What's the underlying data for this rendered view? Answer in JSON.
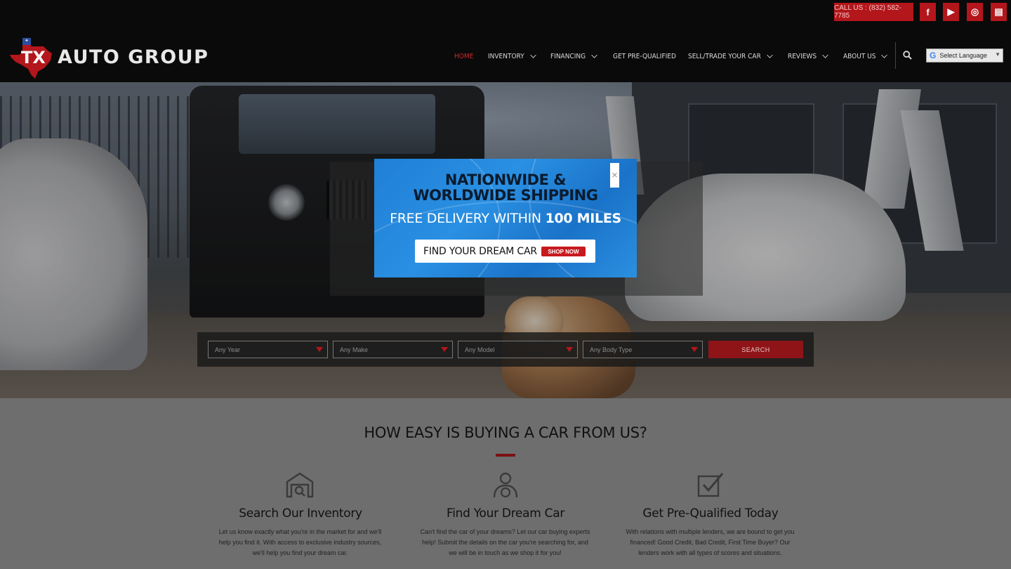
{
  "header": {
    "call_label": "CALL US : (832) 582-7785",
    "logo_text": "AUTO GROUP",
    "logo_mark": "TX",
    "social": [
      {
        "icon": "facebook-icon",
        "glyph": "f"
      },
      {
        "icon": "youtube-icon",
        "glyph": "▶"
      },
      {
        "icon": "instagram-icon",
        "glyph": "◎"
      },
      {
        "icon": "store-icon",
        "glyph": "▤"
      }
    ],
    "nav": [
      {
        "label": "HOME",
        "active": true,
        "dropdown": false
      },
      {
        "label": "INVENTORY",
        "dropdown": true
      },
      {
        "label": "FINANCING",
        "dropdown": true
      },
      {
        "label": "GET PRE-QUALIFIED",
        "dropdown": false
      },
      {
        "label": "SELL/TRADE YOUR CAR",
        "dropdown": true
      },
      {
        "label": "REVIEWS",
        "dropdown": true
      },
      {
        "label": "ABOUT US",
        "dropdown": true
      }
    ],
    "language": "Select Language",
    "language_g": "G"
  },
  "popup": {
    "title": "NATIONWIDE &",
    "title2": "WORLDWIDE SHIPPING",
    "subtitle_prefix": "FREE DELIVERY WITHIN ",
    "subtitle_bold": "100 MILES",
    "cta": "FIND YOUR DREAM CAR",
    "shop": "SHOP NOW",
    "close": "×"
  },
  "search": {
    "fields": [
      "Any Year",
      "Any Make",
      "Any Model",
      "Any Body Type"
    ],
    "button": "SEARCH"
  },
  "section": {
    "heading": "HOW EASY IS BUYING A CAR FROM US?",
    "steps": [
      {
        "title": "Search Our Inventory",
        "icon": "garage-search-icon",
        "lines": [
          "Let us know exactly what you're in the market for and we'll",
          "help you find it. With access to exclusive industry sources,",
          "we'll help you find your dream car."
        ]
      },
      {
        "title": "Find Your Dream Car",
        "icon": "driver-icon",
        "lines": [
          "Can't find the car of your dreams? Let our car buying experts",
          "help! Submit the details on the car you're searching for, and",
          "we will be in touch as we shop it for you!"
        ]
      },
      {
        "title": "Get Pre-Qualified Today",
        "icon": "checkbox-icon",
        "lines": [
          "With relations with multiple lenders, we are bound to get you",
          "financed! Good Credit, Bad Credit, First Time Buyer? Our",
          "lenders work with all types of scores and situations."
        ]
      }
    ]
  },
  "colors": {
    "accent": "#b3161b",
    "popup_blue": "#2a90e3"
  }
}
